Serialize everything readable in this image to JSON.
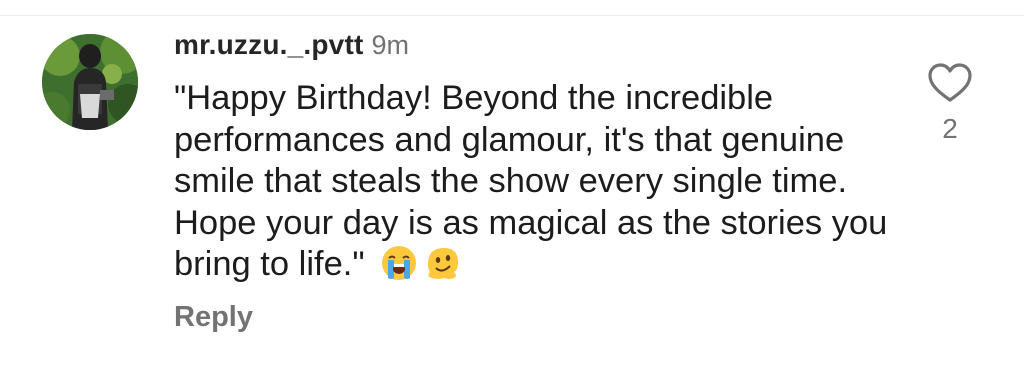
{
  "comment": {
    "username": "mr.uzzu._.pvtt",
    "timestamp": "9m",
    "text": "\"Happy Birthday! Beyond the incredible performances and glamour, it's that genuine smile that steals the show every single time. Hope your day is as magical as the stories you bring to life.\"",
    "emojis": [
      "loudly-crying-face",
      "melting-face"
    ],
    "reply_label": "Reply",
    "like_count": "2",
    "like_icon": "heart-outline-icon"
  },
  "colors": {
    "username": "#262626",
    "secondary": "#737373",
    "text": "#1c1c1c"
  }
}
